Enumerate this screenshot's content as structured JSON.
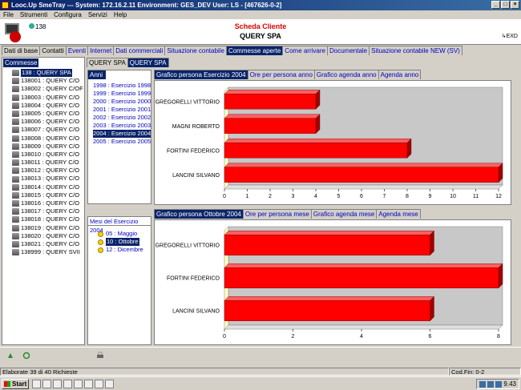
{
  "window": {
    "title": "Looc.Up SmeTray --- System: 172.16.2.11 Environment: GES_DEV User: LS - [467626-0-2]",
    "controls": [
      "_",
      "□",
      "×"
    ]
  },
  "menu": [
    "File",
    "Strumenti",
    "Configura",
    "Servizi",
    "Help"
  ],
  "header": {
    "user_count": "138",
    "title": "Scheda Cliente",
    "subtitle": "QUERY SPA",
    "exit_label": "EXD"
  },
  "main_tabs": [
    {
      "label": "Dati di base"
    },
    {
      "label": "Contatti"
    },
    {
      "label": "Eventi"
    },
    {
      "label": "Internet"
    },
    {
      "label": "Dati commerciali"
    },
    {
      "label": "Situazione contabile"
    },
    {
      "label": "Commesse aperte"
    },
    {
      "label": "Come arrivare"
    },
    {
      "label": "Documentale"
    },
    {
      "label": "Situazione contabile NEW (SV)"
    }
  ],
  "commesse": {
    "title": "Commesse",
    "items": [
      "138 : QUERY SPA",
      "138001 : QUERY C/O",
      "138002 : QUERY C/OF",
      "138003 : QUERY C/O",
      "138004 : QUERY C/O",
      "138005 : QUERY C/O",
      "138006 : QUERY C/O",
      "138007 : QUERY C/O",
      "138008 : QUERY C/O",
      "138009 : QUERY C/O",
      "138010 : QUERY C/O",
      "138011 : QUERY C/O",
      "138012 : QUERY C/O",
      "138013 : QUERY C/O",
      "138014 : QUERY C/O",
      "138015 : QUERY C/O",
      "138016 : QUERY C/O",
      "138017 : QUERY C/O",
      "138018 : QUERY C/O",
      "138019 : QUERY C/O",
      "138020 : QUERY C/O",
      "138021 : QUERY C/O",
      "138999 : QUERY SVII"
    ]
  },
  "query_tabs": [
    "QUERY SPA",
    "QUERY SPA"
  ],
  "anni": {
    "title": "Anni",
    "items": [
      "1998 : Esercizio 1998",
      "1999 : Esercizio 1999",
      "2000 : Esercizio 2000",
      "2001 : Esercizio 2001",
      "2002 : Esercizio 2002",
      "2003 : Esercizio 2003",
      "2004 : Esercizio 2004",
      "2005 : Esercizio 2005"
    ]
  },
  "mesi": {
    "title": "Mesi del Esercizio 2004",
    "items": [
      "05 : Maggio",
      "10 : Ottobre",
      "12 : Dicembre"
    ]
  },
  "chart_tabs_top": [
    "Grafico persona Esercizio 2004",
    "Ore per persona anno",
    "Grafico agenda anno",
    "Agenda anno"
  ],
  "chart_tabs_bottom": [
    "Grafico persona Ottobre 2004",
    "Ore per persona mese",
    "Grafico agenda mese",
    "Agenda mese"
  ],
  "chart_data": [
    {
      "type": "bar",
      "orientation": "horizontal",
      "categories": [
        "GREGORELLI VITTORIO",
        "MAGNI ROBERTO",
        "FORTINI FEDERICO",
        "LANCINI SILVANO"
      ],
      "values": [
        4,
        4,
        8,
        12
      ],
      "xlim": [
        0,
        12
      ],
      "ticks": [
        0,
        1,
        2,
        3,
        4,
        5,
        6,
        7,
        8,
        9,
        10,
        11,
        12
      ],
      "color": "#ff0000"
    },
    {
      "type": "bar",
      "orientation": "horizontal",
      "categories": [
        "GREGORELLI VITTORIO",
        "FORTINI FEDERICO",
        "LANCINI SILVANO"
      ],
      "values": [
        6,
        8,
        6
      ],
      "xlim": [
        0,
        8
      ],
      "ticks": [
        0,
        2,
        4,
        6,
        8
      ],
      "color": "#ff0000"
    }
  ],
  "status": {
    "left": "Elaborate 39 di 40 Richieste",
    "right": "Cod.Fin: 0-2"
  },
  "taskbar": {
    "start": "Start",
    "clock": "9.43"
  }
}
